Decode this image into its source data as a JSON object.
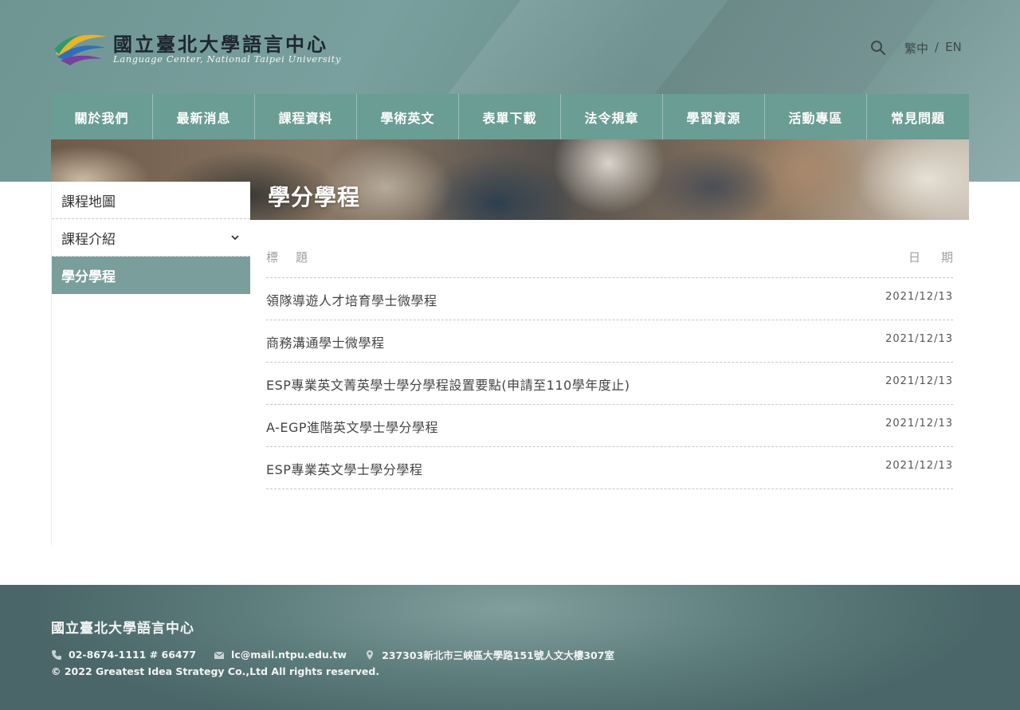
{
  "header": {
    "logo_zh": "國立臺北大學語言中心",
    "logo_en": "Language Center, National Taipei University",
    "lang_zh": "繁中",
    "lang_sep": "/",
    "lang_en": "EN"
  },
  "nav": [
    "關於我們",
    "最新消息",
    "課程資料",
    "學術英文",
    "表單下載",
    "法令規章",
    "學習資源",
    "活動專區",
    "常見問題"
  ],
  "banner": {
    "title": "學分學程"
  },
  "sidebar": {
    "items": [
      {
        "label": "課程地圖"
      },
      {
        "label": "課程介紹"
      },
      {
        "label": "學分學程"
      }
    ]
  },
  "list": {
    "header_title": "標題",
    "header_date": "日期",
    "rows": [
      {
        "title": "領隊導遊人才培育學士微學程",
        "date": "2021/12/13"
      },
      {
        "title": "商務溝通學士微學程",
        "date": "2021/12/13"
      },
      {
        "title": "ESP專業英文菁英學士學分學程設置要點(申請至110學年度止)",
        "date": "2021/12/13"
      },
      {
        "title": "A-EGP進階英文學士學分學程",
        "date": "2021/12/13"
      },
      {
        "title": "ESP專業英文學士學分學程",
        "date": "2021/12/13"
      }
    ]
  },
  "footer": {
    "title": "國立臺北大學語言中心",
    "phone": "02-8674-1111 # 66477",
    "email": "lc@mail.ntpu.edu.tw",
    "address": "237303新北市三峽區大學路151號人文大樓307室",
    "copyright": "© 2022 Greatest Idea Strategy Co.,Ltd All rights reserved."
  },
  "colors": {
    "nav_bg": "#6a9d93",
    "sidebar_active": "#7a9e9b",
    "header_bg": "#79a09e"
  }
}
